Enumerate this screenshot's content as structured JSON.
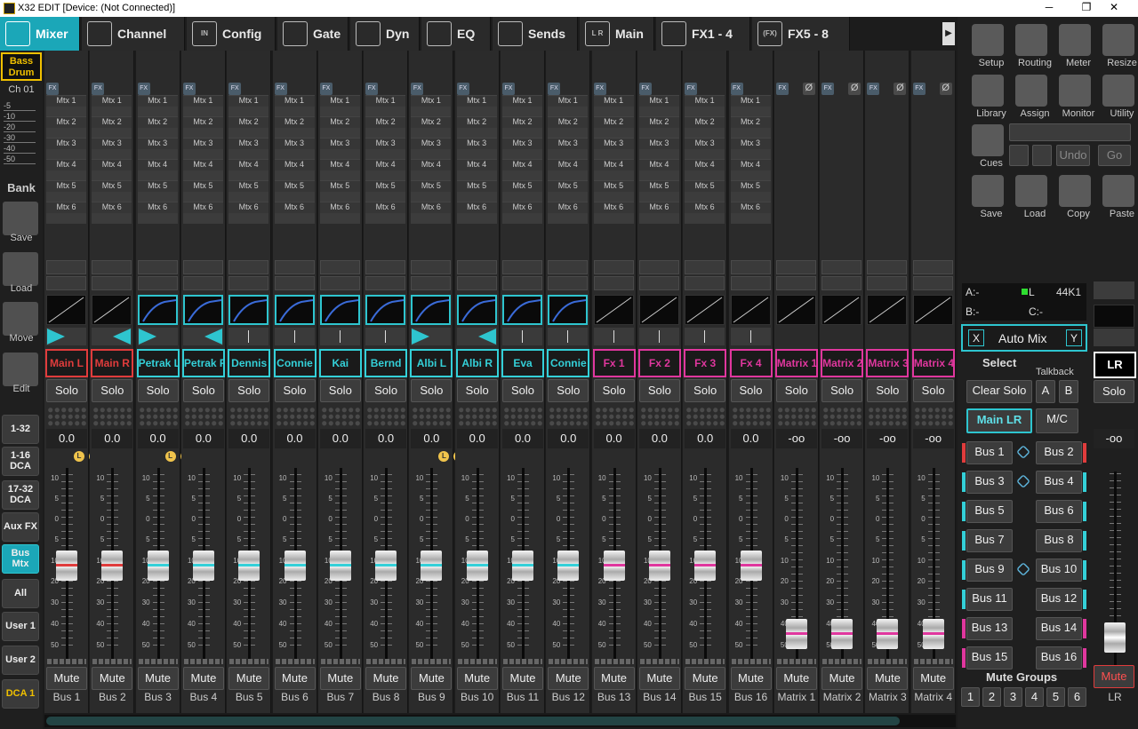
{
  "window": {
    "title": "X32 EDIT [Device: (Not Connected)]",
    "min": "─",
    "restore": "❐",
    "close": "✕"
  },
  "tabs": [
    {
      "label": "Mixer",
      "icon": "mixer-icon"
    },
    {
      "label": "Channel",
      "icon": "channel-icon"
    },
    {
      "label": "Config",
      "icon": "config-icon",
      "icon_text": "IN"
    },
    {
      "label": "Gate",
      "icon": "gate-icon"
    },
    {
      "label": "Dyn",
      "icon": "dyn-icon"
    },
    {
      "label": "EQ",
      "icon": "eq-icon"
    },
    {
      "label": "Sends",
      "icon": "sends-icon"
    },
    {
      "label": "Main",
      "icon": "main-icon",
      "icon_text": "L R"
    },
    {
      "label": "FX1 - 4",
      "icon": "fx-wave-icon"
    },
    {
      "label": "FX5 - 8",
      "icon": "fx-icon",
      "icon_text": "(FX)"
    }
  ],
  "tabs_next": "▶",
  "left": {
    "selected_name": "Bass Drum",
    "selected_ch": "Ch 01",
    "scale": [
      "-5",
      "-10",
      "-20",
      "-30",
      "-40",
      "-50"
    ],
    "bank": "Bank",
    "save": "Save",
    "load": "Load",
    "move": "Move",
    "edit": "Edit",
    "banks": [
      "1-32",
      "1-16 DCA",
      "17-32 DCA",
      "Aux FX",
      "Bus Mtx",
      "All",
      "User 1",
      "User 2",
      "DCA 1"
    ],
    "active_bank": "Bus Mtx"
  },
  "strips": [
    {
      "name": "Main L",
      "color": "#e03c3c",
      "val": "0.0",
      "bus": "Bus 1",
      "gate": false,
      "pan": "right",
      "lr": true,
      "fader_level": 0.58,
      "fx": true
    },
    {
      "name": "Main R",
      "color": "#e03c3c",
      "val": "0.0",
      "bus": "Bus 2",
      "gate": false,
      "pan": "left",
      "lr": false,
      "fader_level": 0.58,
      "fx": true
    },
    {
      "name": "Petrak  L",
      "color": "#34d0d8",
      "val": "0.0",
      "bus": "Bus 3",
      "gate": true,
      "pan": "right",
      "lr": true,
      "fader_level": 0.58,
      "fx": true
    },
    {
      "name": "Petrak  R",
      "color": "#34d0d8",
      "val": "0.0",
      "bus": "Bus 4",
      "gate": true,
      "pan": "left",
      "lr": false,
      "fader_level": 0.58,
      "fx": true
    },
    {
      "name": "Dennis",
      "color": "#34d0d8",
      "val": "0.0",
      "bus": "Bus 5",
      "gate": true,
      "pan": "center",
      "lr": false,
      "fader_level": 0.58,
      "fx": true
    },
    {
      "name": "Connie",
      "color": "#34d0d8",
      "val": "0.0",
      "bus": "Bus 6",
      "gate": true,
      "pan": "center",
      "lr": false,
      "fader_level": 0.58,
      "fx": true
    },
    {
      "name": "Kai",
      "color": "#34d0d8",
      "val": "0.0",
      "bus": "Bus 7",
      "gate": true,
      "pan": "center",
      "lr": false,
      "fader_level": 0.58,
      "fx": true
    },
    {
      "name": "Bernd",
      "color": "#34d0d8",
      "val": "0.0",
      "bus": "Bus 8",
      "gate": true,
      "pan": "center",
      "lr": false,
      "fader_level": 0.58,
      "fx": true
    },
    {
      "name": "Albi      L",
      "color": "#34d0d8",
      "val": "0.0",
      "bus": "Bus 9",
      "gate": true,
      "pan": "right",
      "lr": true,
      "fader_level": 0.58,
      "fx": true
    },
    {
      "name": "Albi      R",
      "color": "#34d0d8",
      "val": "0.0",
      "bus": "Bus 10",
      "gate": true,
      "pan": "left",
      "lr": false,
      "fader_level": 0.58,
      "fx": true
    },
    {
      "name": "Eva",
      "color": "#34d0d8",
      "val": "0.0",
      "bus": "Bus 11",
      "gate": true,
      "pan": "center",
      "lr": false,
      "fader_level": 0.58,
      "fx": true
    },
    {
      "name": "Connie",
      "color": "#34d0d8",
      "val": "0.0",
      "bus": "Bus 12",
      "gate": true,
      "pan": "center",
      "lr": false,
      "fader_level": 0.58,
      "fx": true
    },
    {
      "name": "Fx 1",
      "color": "#e0379e",
      "val": "0.0",
      "bus": "Bus 13",
      "gate": false,
      "pan": "center",
      "lr": false,
      "fader_level": 0.58,
      "fx": true
    },
    {
      "name": "Fx 2",
      "color": "#e0379e",
      "val": "0.0",
      "bus": "Bus 14",
      "gate": false,
      "pan": "center",
      "lr": false,
      "fader_level": 0.58,
      "fx": true
    },
    {
      "name": "Fx 3",
      "color": "#e0379e",
      "val": "0.0",
      "bus": "Bus 15",
      "gate": false,
      "pan": "center",
      "lr": false,
      "fader_level": 0.58,
      "fx": true
    },
    {
      "name": "Fx 4",
      "color": "#e0379e",
      "val": "0.0",
      "bus": "Bus 16",
      "gate": false,
      "pan": "center",
      "lr": false,
      "fader_level": 0.58,
      "fx": true
    },
    {
      "name": "Matrix 1",
      "color": "#e0379e",
      "val": "-oo",
      "bus": "Matrix 1",
      "gate": false,
      "pan": "none",
      "lr": false,
      "fader_level": 0.0,
      "fx": false
    },
    {
      "name": "Matrix 2",
      "color": "#e0379e",
      "val": "-oo",
      "bus": "Matrix 2",
      "gate": false,
      "pan": "none",
      "lr": false,
      "fader_level": 0.0,
      "fx": false
    },
    {
      "name": "Matrix 3",
      "color": "#e0379e",
      "val": "-oo",
      "bus": "Matrix 3",
      "gate": false,
      "pan": "none",
      "lr": false,
      "fader_level": 0.0,
      "fx": false
    },
    {
      "name": "Matrix 4",
      "color": "#e0379e",
      "val": "-oo",
      "bus": "Matrix 4",
      "gate": false,
      "pan": "none",
      "lr": false,
      "fader_level": 0.0,
      "fx": false
    }
  ],
  "strip_common": {
    "fx": "FX",
    "phase": "Ø",
    "solo": "Solo",
    "mute": "Mute",
    "lr_l": "L",
    "lr_r": "R",
    "mtx": [
      "Mtx 1",
      "Mtx 2",
      "Mtx 3",
      "Mtx 4",
      "Mtx 5",
      "Mtx 6"
    ],
    "scale": [
      "10",
      "5",
      "0",
      "5",
      "10",
      "20",
      "30",
      "40",
      "50"
    ]
  },
  "right": {
    "tools": [
      {
        "label": "Setup",
        "icon": "setup-gear-icon"
      },
      {
        "label": "Routing",
        "icon": "routing-icon"
      },
      {
        "label": "Meter",
        "icon": "meter-icon"
      },
      {
        "label": "Resize",
        "icon": "resize-icon"
      },
      {
        "label": "Library",
        "icon": "library-icon"
      },
      {
        "label": "Assign",
        "icon": "assign-icon"
      },
      {
        "label": "Monitor",
        "icon": "monitor-headphones-icon"
      },
      {
        "label": "Utility",
        "icon": "utility-wrench-icon"
      }
    ],
    "cues": "Cues",
    "undo": "Undo",
    "go": "Go",
    "file": [
      {
        "label": "Save",
        "icon": "save-icon"
      },
      {
        "label": "Load",
        "icon": "load-icon"
      },
      {
        "label": "Copy",
        "icon": "copy-icon"
      },
      {
        "label": "Paste",
        "icon": "paste-icon"
      }
    ],
    "status": {
      "a": "A:-",
      "l": "L",
      "rate": "44K1",
      "b": "B:-",
      "c": "C:-"
    },
    "automix": {
      "x": "X",
      "label": "Auto Mix",
      "y": "Y"
    },
    "select": "Select",
    "talkback": "Talkback",
    "clear_solo": "Clear Solo",
    "tb_a": "A",
    "tb_b": "B",
    "main_lr": "Main LR",
    "mc": "M/C",
    "buses": [
      "Bus 1",
      "Bus 2",
      "Bus 3",
      "Bus 4",
      "Bus 5",
      "Bus 6",
      "Bus 7",
      "Bus 8",
      "Bus 9",
      "Bus 10",
      "Bus 11",
      "Bus 12",
      "Bus 13",
      "Bus 14",
      "Bus 15",
      "Bus 16"
    ],
    "bus_colors": [
      "#e03c3c",
      "#e03c3c",
      "#34d0d8",
      "#34d0d8",
      "#34d0d8",
      "#34d0d8",
      "#34d0d8",
      "#34d0d8",
      "#34d0d8",
      "#34d0d8",
      "#34d0d8",
      "#34d0d8",
      "#e0379e",
      "#e0379e",
      "#e0379e",
      "#e0379e"
    ],
    "links": [
      true,
      true,
      false,
      false,
      true,
      false,
      false,
      false
    ],
    "mute_groups": "Mute Groups",
    "mg": [
      "1",
      "2",
      "3",
      "4",
      "5",
      "6"
    ],
    "lr_strip": {
      "name": "LR",
      "solo": "Solo",
      "val": "-oo",
      "mute": "Mute",
      "label": "LR"
    }
  }
}
